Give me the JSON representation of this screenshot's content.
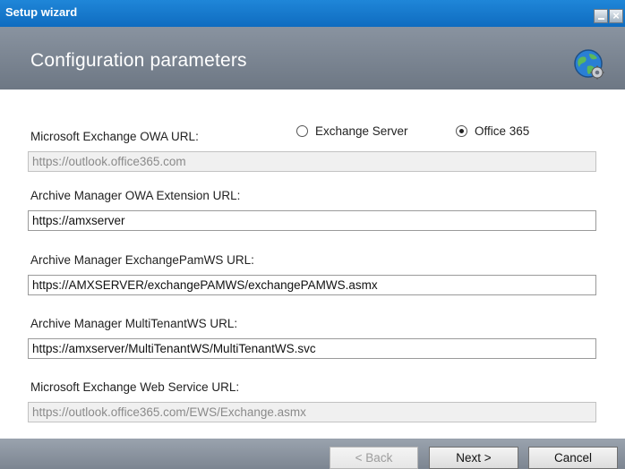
{
  "window": {
    "title": "Setup wizard"
  },
  "header": {
    "title": "Configuration parameters",
    "icon": "globe-gear-icon"
  },
  "owa": {
    "label": "Microsoft Exchange OWA URL:",
    "value": "https://outlook.office365.com",
    "mode": {
      "options": [
        {
          "label": "Exchange Server",
          "selected": false
        },
        {
          "label": "Office 365",
          "selected": true
        }
      ]
    }
  },
  "extension": {
    "label": "Archive Manager OWA Extension URL:",
    "value": "https://amxserver"
  },
  "pamws": {
    "label": "Archive Manager ExchangePamWS URL:",
    "value": "https://AMXSERVER/exchangePAMWS/exchangePAMWS.asmx"
  },
  "multitenant": {
    "label": "Archive Manager MultiTenantWS URL:",
    "value": "https://amxserver/MultiTenantWS/MultiTenantWS.svc"
  },
  "ews": {
    "label": "Microsoft Exchange Web Service URL:",
    "value": "https://outlook.office365.com/EWS/Exchange.asmx"
  },
  "buttons": {
    "back": "< Back",
    "next": "Next >",
    "cancel": "Cancel"
  }
}
